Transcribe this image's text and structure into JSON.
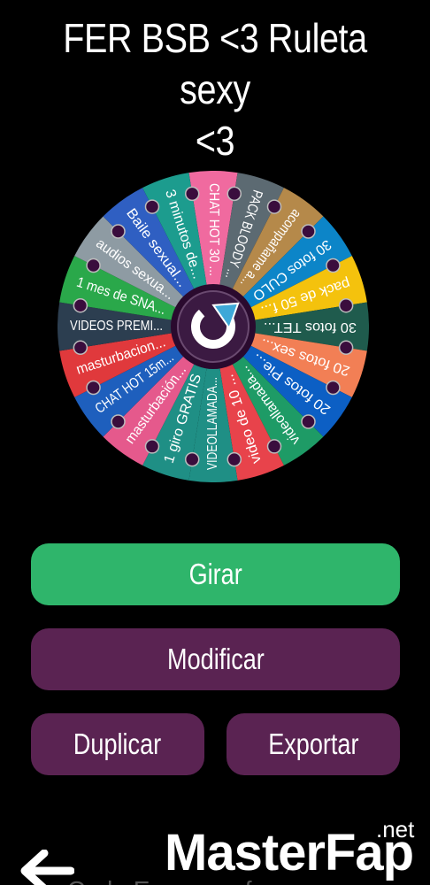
{
  "title": {
    "line1": "FER BSB <3 Ruleta sexy",
    "line2": "<3"
  },
  "wheel": {
    "segments": [
      {
        "label": "CHAT HOT 30 ...",
        "color": "#f06a9f"
      },
      {
        "label": "PACK BLOODY ...",
        "color": "#5c6a72"
      },
      {
        "label": "acompañame a...",
        "color": "#b5894a"
      },
      {
        "label": "30 fotos CULO",
        "color": "#0c85c8"
      },
      {
        "label": "pack de 50 f...",
        "color": "#f4c20d"
      },
      {
        "label": "30 fotos TET...",
        "color": "#1f5b4d"
      },
      {
        "label": "20 fotos sex...",
        "color": "#f27f55"
      },
      {
        "label": "20 fotos Pie...",
        "color": "#0c5fc4"
      },
      {
        "label": "videollamada...",
        "color": "#1e9b66"
      },
      {
        "label": "video de 10 ...",
        "color": "#e8434b"
      },
      {
        "label": "VIDEOLLAMADA...",
        "color": "#1f8f85"
      },
      {
        "label": "1 giro GRATIS",
        "color": "#1f8f85"
      },
      {
        "label": "masturbación...",
        "color": "#e5598c"
      },
      {
        "label": "CHAT HOT 15m...",
        "color": "#1e5fbd"
      },
      {
        "label": "masturbacion...",
        "color": "#e0393c"
      },
      {
        "label": "VIDEOS PREMI...",
        "color": "#2c3e50"
      },
      {
        "label": "1 mes de SNA...",
        "color": "#2aa84a"
      },
      {
        "label": "audios sexua...",
        "color": "#8e9ba3"
      },
      {
        "label": "Baile sexual...",
        "color": "#2f5fc2"
      },
      {
        "label": "3 minutos de...",
        "color": "#1c9c8e"
      }
    ],
    "center_icon": "refresh-icon",
    "colors": {
      "center_ring": "#2a0a2e",
      "center_fill": "#3b1a42",
      "peg": "#3a0d3d",
      "arrow": "#3ea8d8"
    }
  },
  "buttons": {
    "girar": "Girar",
    "modificar": "Modificar",
    "duplicar": "Duplicar",
    "exportar": "Exportar"
  },
  "footer": {
    "back_icon": "arrow-left-icon",
    "watermark": "MasterFap",
    "watermark_suffix": ".net",
    "cut_text": "Cada Escena, ¿fue..."
  }
}
